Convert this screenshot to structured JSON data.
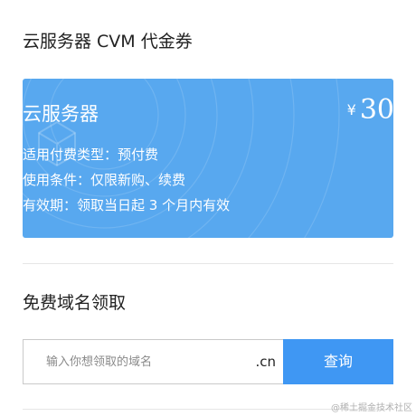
{
  "section1": {
    "title": "云服务器 CVM 代金券"
  },
  "voucher": {
    "name": "云服务器",
    "currency": "¥",
    "amount": "30",
    "lines": [
      "适用付费类型：预付费",
      "使用条件：仅限新购、续费",
      "有效期：领取当日起 3 个月内有效"
    ]
  },
  "section2": {
    "title": "免费域名领取"
  },
  "search": {
    "placeholder": "输入你想领取的域名",
    "value": "",
    "suffix": ".cn",
    "button_label": "查询"
  },
  "watermark": "@稀土掘金技术社区",
  "colors": {
    "voucher_bg": "#58a8ef",
    "button_bg": "#3f97f3"
  }
}
